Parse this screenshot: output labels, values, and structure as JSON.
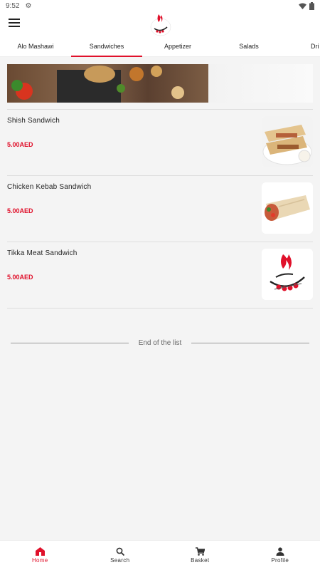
{
  "status_bar": {
    "time": "9:52"
  },
  "tabs": [
    "Alo Mashawi",
    "Sandwiches",
    "Appetizer",
    "Salads",
    "Dri"
  ],
  "active_tab": 1,
  "items": [
    {
      "name": "Shish Sandwich",
      "price": "5.00AED",
      "image": "wrap-platter"
    },
    {
      "name": "Chicken Kebab Sandwich",
      "price": "5.00AED",
      "image": "wrap"
    },
    {
      "name": "Tikka Meat Sandwich",
      "price": "5.00AED",
      "image": "brand-logo"
    }
  ],
  "end_of_list": "End of the list",
  "bottom_nav": [
    {
      "label": "Home",
      "icon": "home-icon"
    },
    {
      "label": "Search",
      "icon": "search-icon"
    },
    {
      "label": "Basket",
      "icon": "cart-icon"
    },
    {
      "label": "Profile",
      "icon": "person-icon"
    }
  ],
  "colors": {
    "accent": "#e0112b"
  }
}
